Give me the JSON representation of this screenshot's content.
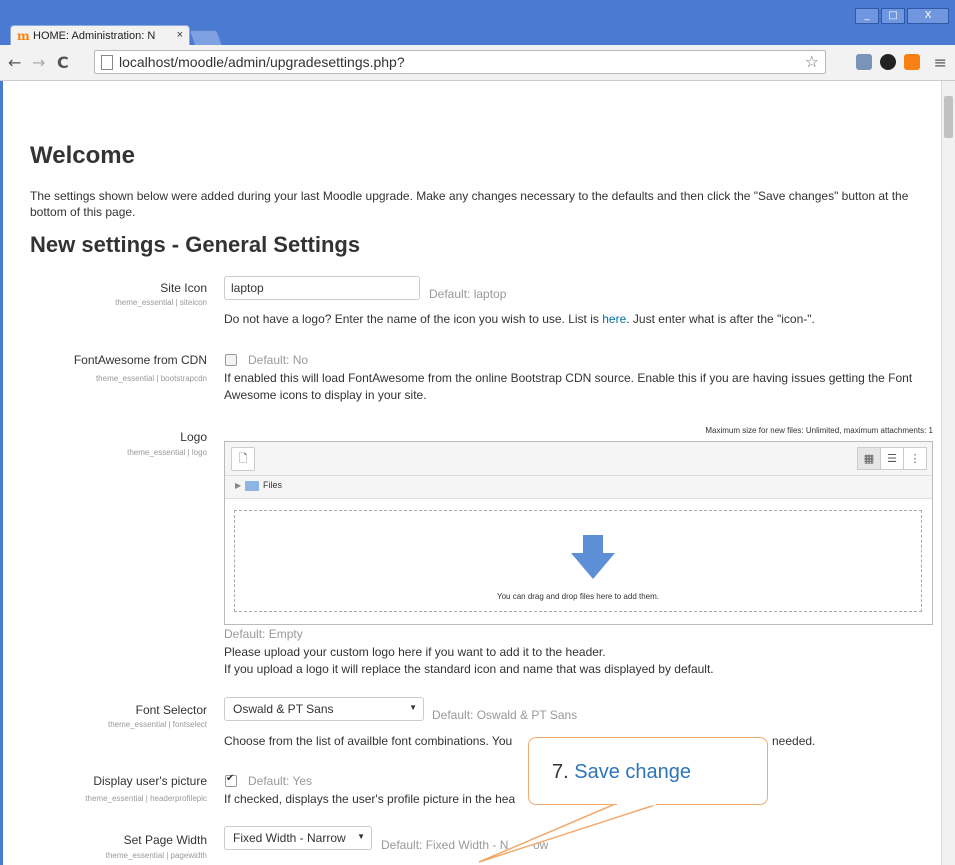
{
  "browser": {
    "tab_title": "HOME: Administration: N",
    "tab_close": "×",
    "url": "localhost/moodle/admin/upgradesettings.php?",
    "window_buttons": [
      "_",
      "□",
      "X"
    ]
  },
  "page": {
    "heading": "Welcome",
    "intro": "The settings shown below were added during your last Moodle upgrade. Make any changes necessary to the defaults and then click the \"Save changes\" button at the bottom of this page.",
    "section_title": "New settings - General Settings"
  },
  "settings": {
    "site_icon": {
      "label": "Site Icon",
      "key": "theme_essential | siteicon",
      "value": "laptop",
      "default": "Default: laptop",
      "desc_before": "Do not have a logo? Enter the name of the icon you wish to use. List is ",
      "desc_link": "here",
      "desc_after": ". Just enter what is after the \"icon-\"."
    },
    "fontawesome_cdn": {
      "label": "FontAwesome from CDN",
      "key": "theme_essential | bootstrapcdn",
      "checked": false,
      "default": "Default: No",
      "desc": "If enabled this will load FontAwesome from the online Bootstrap CDN source. Enable this if you are having issues getting the Font Awesome icons to display in your site."
    },
    "logo": {
      "label": "Logo",
      "key": "theme_essential | logo",
      "max_size": "Maximum size for new files: Unlimited, maximum attachments: 1",
      "folder": "Files",
      "drop_text": "You can drag and drop files here to add them.",
      "default": "Default: Empty",
      "desc1": "Please upload your custom logo here if you want to add it to the header.",
      "desc2": "If you upload a logo it will replace the standard icon and name that was displayed by default."
    },
    "font_selector": {
      "label": "Font Selector",
      "key": "theme_essential | fontselect",
      "value": "Oswald & PT Sans",
      "default": "Default: Oswald & PT Sans",
      "desc_start": "Choose from the list of availble font combinations. You",
      "desc_end": "needed."
    },
    "display_picture": {
      "label": "Display user's picture",
      "key": "theme_essential | headerprofilepic",
      "checked": true,
      "default": "Default: Yes",
      "desc": "If checked, displays the user's profile picture in the hea"
    },
    "page_width": {
      "label": "Set Page Width",
      "key": "theme_essential | pagewidth",
      "value": "Fixed Width - Narrow",
      "default_start": "Default: Fixed Width - N",
      "default_end": "ow"
    }
  },
  "annotation": {
    "number": "7. ",
    "text": "Save change",
    "accent_color": "#2d75b8",
    "border_color": "#f0a96b"
  }
}
